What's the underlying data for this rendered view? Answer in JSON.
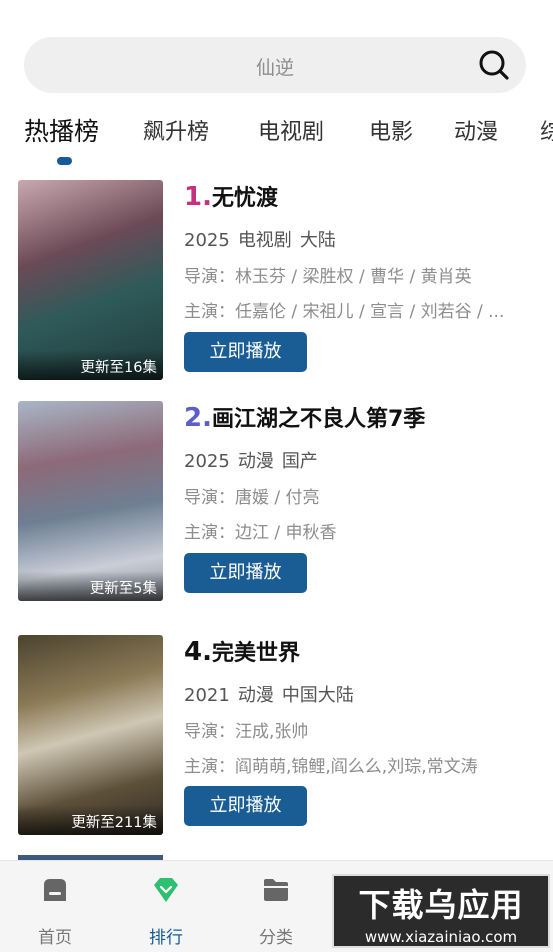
{
  "search": {
    "placeholder": "仙逆"
  },
  "tabs": [
    "热播榜",
    "飙升榜",
    "电视剧",
    "电影",
    "动漫",
    "综"
  ],
  "items": [
    {
      "rank": "1.",
      "name": "无忧渡",
      "rank_color": "#c4327e",
      "year": "2025",
      "type": "电视剧",
      "region": "大陆",
      "director": "导演：林玉芬 / 梁胜权 / 曹华 / 黄肖英",
      "cast": "主演：任嘉伦 / 宋祖儿 / 宣言 / 刘若谷 / ...",
      "episodes": "更新至16集",
      "play_label": "立即播放"
    },
    {
      "rank": "2.",
      "name": "画江湖之不良人第7季",
      "rank_color": "#5b5fc7",
      "year": "2025",
      "type": "动漫",
      "region": "国产",
      "director": "导演：唐媛 / 付亮",
      "cast": "主演：边江 / 申秋香",
      "episodes": "更新至5集",
      "play_label": "立即播放"
    },
    {
      "rank": "4.",
      "name": "完美世界",
      "rank_color": "#111111",
      "year": "2021",
      "type": "动漫",
      "region": "中国大陆",
      "director": "导演：汪成,张帅",
      "cast": "主演：阎萌萌,锦鲤,阎么么,刘琮,常文涛",
      "episodes": "更新至211集",
      "play_label": "立即播放"
    }
  ],
  "nav": [
    {
      "label": "首页",
      "icon": "home-icon"
    },
    {
      "label": "排行",
      "icon": "ranking-icon"
    },
    {
      "label": "分类",
      "icon": "folder-icon"
    }
  ],
  "watermark": {
    "big": "下载乌应用",
    "small": "www.xiazainiao.com"
  }
}
